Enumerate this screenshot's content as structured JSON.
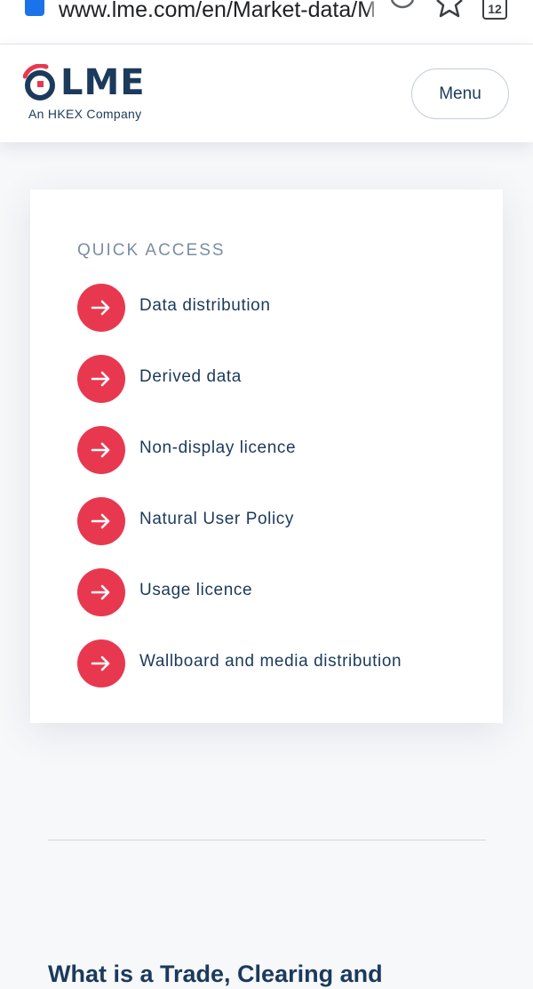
{
  "browser": {
    "url": "www.lme.com/en/Market-data/Ma",
    "tab_count": "12",
    "icons": [
      "lock-icon",
      "reload-icon",
      "star-icon",
      "tabs-icon"
    ]
  },
  "header": {
    "logo_text": "LME",
    "logo_tagline": "An HKEX Company",
    "menu_label": "Menu",
    "colors": {
      "brand_navy": "#1b3a5c",
      "brand_red": "#e8384f"
    }
  },
  "quick_access": {
    "title": "QUICK ACCESS",
    "items": [
      {
        "label": "Data distribution",
        "icon": "arrow-right-icon"
      },
      {
        "label": "Derived data",
        "icon": "arrow-right-icon"
      },
      {
        "label": "Non-display licence",
        "icon": "arrow-right-icon"
      },
      {
        "label": "Natural User Policy",
        "icon": "arrow-right-icon"
      },
      {
        "label": "Usage licence",
        "icon": "arrow-right-icon"
      },
      {
        "label": "Wallboard and media distribution",
        "icon": "arrow-right-icon"
      }
    ]
  },
  "main": {
    "section_heading": "What is a Trade, Clearing and"
  }
}
